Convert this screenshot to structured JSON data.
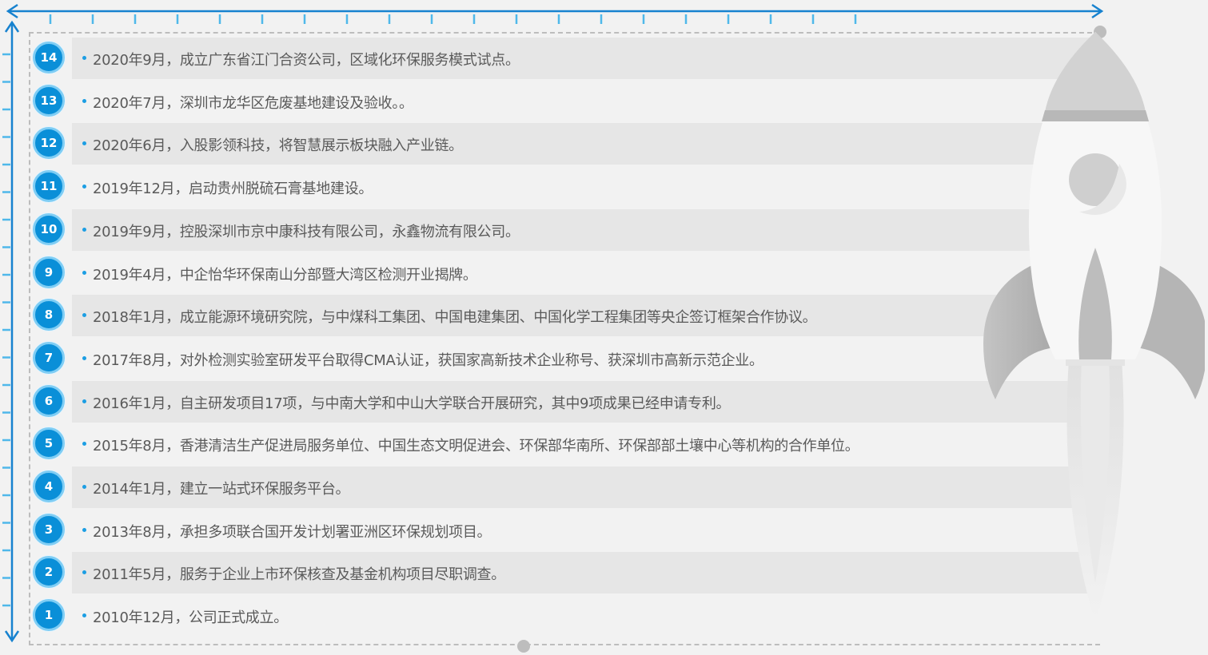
{
  "timeline": {
    "events": [
      {
        "num": "14",
        "text": "2020年9月，成立广东省江门合资公司，区域化环保服务模式试点。"
      },
      {
        "num": "13",
        "text": "2020年7月，深圳市龙华区危废基地建设及验收。。"
      },
      {
        "num": "12",
        "text": "2020年6月，入股影领科技，将智慧展示板块融入产业链。"
      },
      {
        "num": "11",
        "text": "2019年12月，启动贵州脱硫石膏基地建设。"
      },
      {
        "num": "10",
        "text": "2019年9月，控股深圳市京中康科技有限公司，永鑫物流有限公司。"
      },
      {
        "num": "9",
        "text": "2019年4月，中企怡华环保南山分部暨大湾区检测开业揭牌。"
      },
      {
        "num": "8",
        "text": "2018年1月，成立能源环境研究院，与中煤科工集团、中国电建集团、中国化学工程集团等央企签订框架合作协议。"
      },
      {
        "num": "7",
        "text": "2017年8月，对外检测实验室研发平台取得CMA认证，获国家高新技术企业称号、获深圳市高新示范企业。"
      },
      {
        "num": "6",
        "text": "2016年1月，自主研发项目17项，与中南大学和中山大学联合开展研究，其中9项成果已经申请专利。"
      },
      {
        "num": "5",
        "text": "2015年8月，香港清洁生产促进局服务单位、中国生态文明促进会、环保部华南所、环保部部土壤中心等机构的合作单位。"
      },
      {
        "num": "4",
        "text": "2014年1月，建立一站式环保服务平台。"
      },
      {
        "num": "3",
        "text": "2013年8月，承担多项联合国开发计划署亚洲区环保规划项目。"
      },
      {
        "num": "2",
        "text": "2011年5月，服务于企业上市环保核查及基金机构项目尽职调查。"
      },
      {
        "num": "1",
        "text": "2010年12月，公司正式成立。"
      }
    ]
  },
  "colors": {
    "axis": "#1782cf",
    "badge": "#0a8fd8",
    "badge_ring": "#7fcdf4",
    "row_shade": "#e6e6e6",
    "text": "#5a5a5a"
  },
  "icons": {
    "rocket": "rocket-icon",
    "arrow_right": "arrow-right-icon",
    "arrow_vertical": "arrow-updown-icon"
  }
}
